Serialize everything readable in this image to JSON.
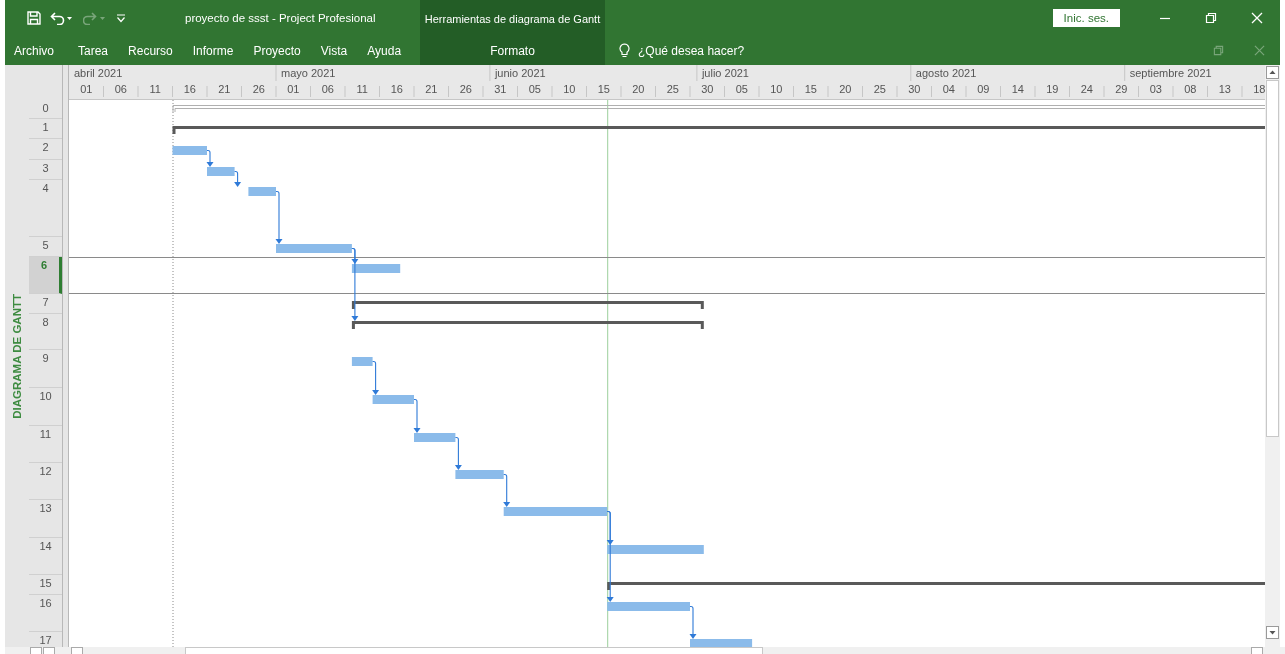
{
  "window": {
    "title": "proyecto de ssst  -  Project Profesional",
    "context_group": "Herramientas de diagrama de Gantt",
    "sign_in": "Inic. ses."
  },
  "quick_access": [
    {
      "kind": "save",
      "disabled": false
    },
    {
      "kind": "undo",
      "disabled": false
    },
    {
      "kind": "redo",
      "disabled": true
    },
    {
      "kind": "customize",
      "disabled": false
    }
  ],
  "ribbon_tabs": [
    {
      "label": "Archivo",
      "kind": "tab"
    },
    {
      "label": "Tarea",
      "kind": "tab"
    },
    {
      "label": "Recurso",
      "kind": "tab"
    },
    {
      "label": "Informe",
      "kind": "tab"
    },
    {
      "label": "Proyecto",
      "kind": "tab"
    },
    {
      "label": "Vista",
      "kind": "tab"
    },
    {
      "label": "Ayuda",
      "kind": "tab"
    },
    {
      "label": "Formato",
      "kind": "contextual"
    }
  ],
  "tell_me": {
    "placeholder": "¿Qué desea hacer?"
  },
  "view_bar": {
    "label": "DIAGRAMA DE GANTT"
  },
  "timescale": {
    "months": [
      "abril 2021",
      "mayo 2021",
      "junio 2021",
      "julio 2021",
      "agosto 2021",
      "septiembre 2021"
    ],
    "days": [
      "01",
      "06",
      "11",
      "16",
      "21",
      "26",
      "01",
      "06",
      "11",
      "16",
      "21",
      "26",
      "31",
      "05",
      "10",
      "15",
      "20",
      "25",
      "30",
      "05",
      "10",
      "15",
      "20",
      "25",
      "30",
      "04",
      "09",
      "14",
      "19",
      "24",
      "29",
      "03",
      "08",
      "13",
      "18"
    ]
  },
  "rows": [
    {
      "number": "0",
      "kind": "project_summary",
      "selected": false
    },
    {
      "number": "1",
      "kind": "summary",
      "selected": false
    },
    {
      "number": "2",
      "kind": "task",
      "selected": false
    },
    {
      "number": "3",
      "kind": "task",
      "selected": false
    },
    {
      "number": "4",
      "kind": "task",
      "selected": false
    },
    {
      "number": "5",
      "kind": "task",
      "selected": false
    },
    {
      "number": "6",
      "kind": "task",
      "selected": true
    },
    {
      "number": "7",
      "kind": "summary",
      "selected": false
    },
    {
      "number": "8",
      "kind": "summary",
      "selected": false
    },
    {
      "number": "9",
      "kind": "task",
      "selected": false
    },
    {
      "number": "10",
      "kind": "task",
      "selected": false
    },
    {
      "number": "11",
      "kind": "task",
      "selected": false
    },
    {
      "number": "12",
      "kind": "task",
      "selected": false
    },
    {
      "number": "13",
      "kind": "task",
      "selected": false
    },
    {
      "number": "14",
      "kind": "task",
      "selected": false
    },
    {
      "number": "15",
      "kind": "summary",
      "selected": false
    },
    {
      "number": "16",
      "kind": "task",
      "selected": false
    },
    {
      "number": "17",
      "kind": "task",
      "selected": false
    }
  ]
}
